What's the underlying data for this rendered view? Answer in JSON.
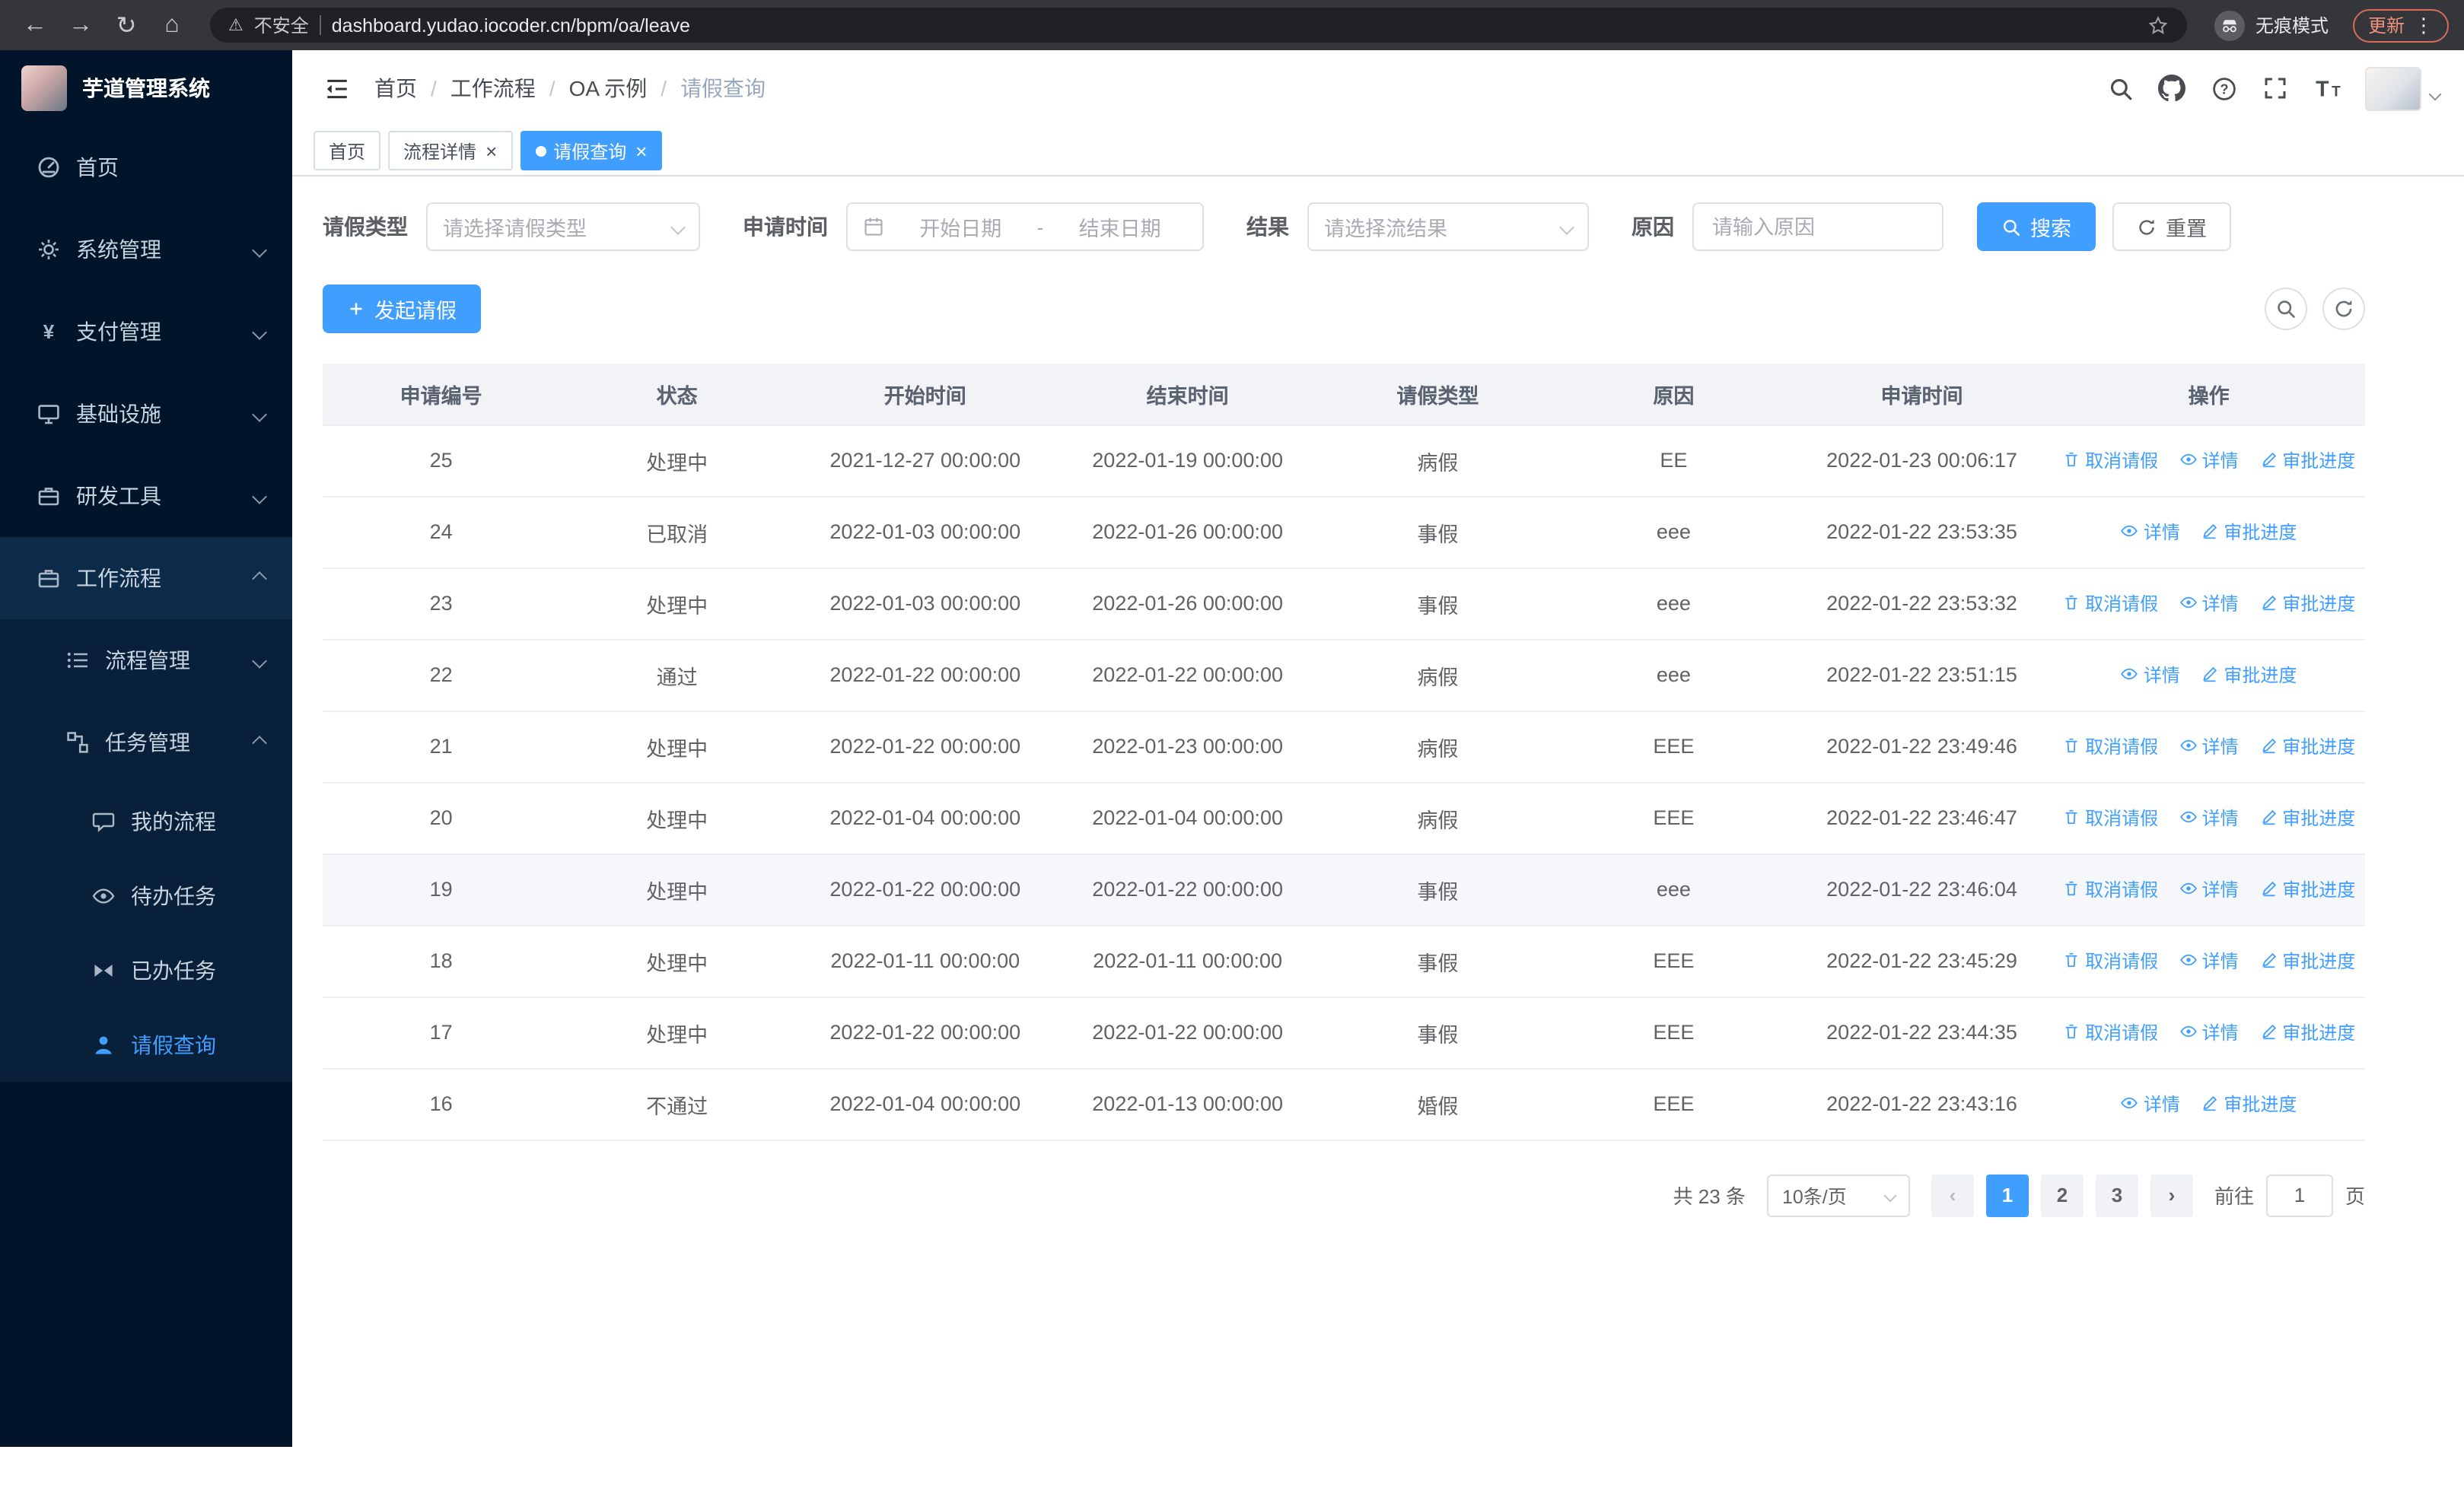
{
  "icons": {
    "back": "←",
    "forward": "→",
    "reload": "↻",
    "home": "⌂",
    "warning": "⚠",
    "dots": "⋮",
    "prev": "‹",
    "next": "›",
    "close": "×"
  },
  "browser": {
    "security_warning": "不安全",
    "url": "dashboard.yudao.iocoder.cn/bpm/oa/leave",
    "incognito_label": "无痕模式",
    "update_button": "更新"
  },
  "sidebar": {
    "logo_title": "芋道管理系统",
    "items": [
      {
        "label": "首页"
      },
      {
        "label": "系统管理"
      },
      {
        "label": "支付管理"
      },
      {
        "label": "基础设施"
      },
      {
        "label": "研发工具"
      },
      {
        "label": "工作流程"
      },
      {
        "label": "流程管理"
      },
      {
        "label": "任务管理"
      },
      {
        "label": "我的流程"
      },
      {
        "label": "待办任务"
      },
      {
        "label": "已办任务"
      },
      {
        "label": "请假查询"
      }
    ]
  },
  "header": {
    "breadcrumb": [
      "首页",
      "工作流程",
      "OA 示例",
      "请假查询"
    ]
  },
  "tabs": [
    {
      "label": "首页"
    },
    {
      "label": "流程详情"
    },
    {
      "label": "请假查询"
    }
  ],
  "filters": {
    "leave_type_label": "请假类型",
    "leave_type_placeholder": "请选择请假类型",
    "apply_time_label": "申请时间",
    "start_date_placeholder": "开始日期",
    "range_separator": "-",
    "end_date_placeholder": "结束日期",
    "result_label": "结果",
    "result_placeholder": "请选择流结果",
    "reason_label": "原因",
    "reason_placeholder": "请输入原因",
    "search_button": "搜索",
    "reset_button": "重置"
  },
  "toolbar": {
    "create_button": "发起请假"
  },
  "table": {
    "columns": [
      "申请编号",
      "状态",
      "开始时间",
      "结束时间",
      "请假类型",
      "原因",
      "申请时间",
      "操作"
    ],
    "action_labels": {
      "cancel": "取消请假",
      "detail": "详情",
      "progress": "审批进度"
    },
    "rows": [
      {
        "id": "25",
        "status": "处理中",
        "start": "2021-12-27 00:00:00",
        "end": "2022-01-19 00:00:00",
        "type": "病假",
        "reason": "EE",
        "apply_time": "2022-01-23 00:06:17",
        "actions": [
          "cancel",
          "detail",
          "progress"
        ]
      },
      {
        "id": "24",
        "status": "已取消",
        "start": "2022-01-03 00:00:00",
        "end": "2022-01-26 00:00:00",
        "type": "事假",
        "reason": "eee",
        "apply_time": "2022-01-22 23:53:35",
        "actions": [
          "detail",
          "progress"
        ]
      },
      {
        "id": "23",
        "status": "处理中",
        "start": "2022-01-03 00:00:00",
        "end": "2022-01-26 00:00:00",
        "type": "事假",
        "reason": "eee",
        "apply_time": "2022-01-22 23:53:32",
        "actions": [
          "cancel",
          "detail",
          "progress"
        ]
      },
      {
        "id": "22",
        "status": "通过",
        "start": "2022-01-22 00:00:00",
        "end": "2022-01-22 00:00:00",
        "type": "病假",
        "reason": "eee",
        "apply_time": "2022-01-22 23:51:15",
        "actions": [
          "detail",
          "progress"
        ]
      },
      {
        "id": "21",
        "status": "处理中",
        "start": "2022-01-22 00:00:00",
        "end": "2022-01-23 00:00:00",
        "type": "病假",
        "reason": "EEE",
        "apply_time": "2022-01-22 23:49:46",
        "actions": [
          "cancel",
          "detail",
          "progress"
        ]
      },
      {
        "id": "20",
        "status": "处理中",
        "start": "2022-01-04 00:00:00",
        "end": "2022-01-04 00:00:00",
        "type": "病假",
        "reason": "EEE",
        "apply_time": "2022-01-22 23:46:47",
        "actions": [
          "cancel",
          "detail",
          "progress"
        ]
      },
      {
        "id": "19",
        "status": "处理中",
        "start": "2022-01-22 00:00:00",
        "end": "2022-01-22 00:00:00",
        "type": "事假",
        "reason": "eee",
        "apply_time": "2022-01-22 23:46:04",
        "actions": [
          "cancel",
          "detail",
          "progress"
        ],
        "highlighted": true
      },
      {
        "id": "18",
        "status": "处理中",
        "start": "2022-01-11 00:00:00",
        "end": "2022-01-11 00:00:00",
        "type": "事假",
        "reason": "EEE",
        "apply_time": "2022-01-22 23:45:29",
        "actions": [
          "cancel",
          "detail",
          "progress"
        ]
      },
      {
        "id": "17",
        "status": "处理中",
        "start": "2022-01-22 00:00:00",
        "end": "2022-01-22 00:00:00",
        "type": "事假",
        "reason": "EEE",
        "apply_time": "2022-01-22 23:44:35",
        "actions": [
          "cancel",
          "detail",
          "progress"
        ]
      },
      {
        "id": "16",
        "status": "不通过",
        "start": "2022-01-04 00:00:00",
        "end": "2022-01-13 00:00:00",
        "type": "婚假",
        "reason": "EEE",
        "apply_time": "2022-01-22 23:43:16",
        "actions": [
          "detail",
          "progress"
        ]
      }
    ]
  },
  "pagination": {
    "total": "共 23 条",
    "page_size": "10条/页",
    "pages": [
      "1",
      "2",
      "3"
    ],
    "goto_label": "前往",
    "goto_value": "1",
    "page_unit": "页"
  }
}
